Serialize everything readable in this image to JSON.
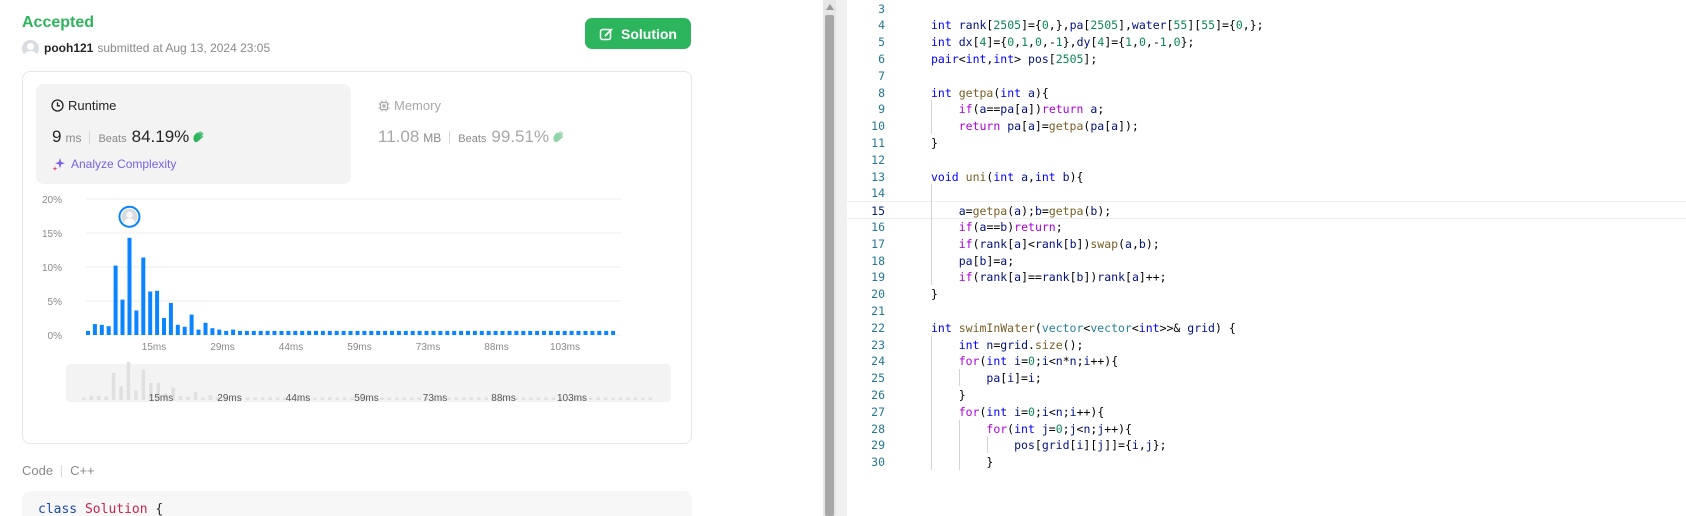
{
  "submission": {
    "status": "Accepted",
    "username": "pooh121",
    "submitted_text": "submitted at Aug 13, 2024 23:05",
    "solution_label": "Solution"
  },
  "runtime": {
    "title": "Runtime",
    "value": "9",
    "unit": "ms",
    "beats_label": "Beats",
    "beats_pct": "84.19%",
    "analyze_label": "Analyze Complexity"
  },
  "memory": {
    "title": "Memory",
    "value": "11.08",
    "unit": "MB",
    "beats_label": "Beats",
    "beats_pct": "99.51%"
  },
  "chart_data": {
    "type": "bar",
    "y_ticks": [
      "20%",
      "15%",
      "10%",
      "5%",
      "0%"
    ],
    "ylim": [
      0,
      20
    ],
    "x_tick_labels": [
      "15ms",
      "29ms",
      "44ms",
      "59ms",
      "73ms",
      "88ms",
      "103ms"
    ],
    "values": [
      0.6,
      1.6,
      1.5,
      1.3,
      10.2,
      5.2,
      14.3,
      3.6,
      11.4,
      6.4,
      6.5,
      2.5,
      4.7,
      1.5,
      1.2,
      3.0,
      0.8,
      1.8,
      1.0,
      0.8,
      0.6,
      0.8,
      0.6,
      0.6,
      0.6,
      0.6,
      0.6,
      0.6,
      0.6,
      0.6,
      0.6,
      0.6,
      0.6,
      0.6,
      0.6,
      0.6,
      0.6,
      0.6,
      0.6,
      0.6,
      0.6,
      0.6,
      0.6,
      0.6,
      0.6,
      0.6,
      0.6,
      0.6,
      0.6,
      0.6,
      0.6,
      0.6,
      0.6,
      0.6,
      0.6,
      0.6,
      0.6,
      0.6,
      0.6,
      0.6,
      0.6,
      0.6,
      0.6,
      0.6,
      0.6,
      0.6,
      0.6,
      0.6,
      0.6,
      0.6,
      0.6,
      0.6,
      0.6,
      0.6,
      0.6,
      0.6,
      0.6
    ],
    "highlight_index": 6,
    "bar_color": "#0a84ff",
    "overview_color": "#e0e0e0"
  },
  "code_section": {
    "label": "Code",
    "language": "C++",
    "preview_keyword": "class",
    "preview_name": "Solution",
    "preview_brace": "{"
  },
  "editor": {
    "active_line": "15",
    "lines": [
      {
        "n": "3",
        "code": ""
      },
      {
        "n": "4",
        "code": "int rank[2505]={0,},pa[2505],water[55][55]={0,};"
      },
      {
        "n": "5",
        "code": "int dx[4]={0,1,0,-1},dy[4]={1,0,-1,0};"
      },
      {
        "n": "6",
        "code": "pair<int,int> pos[2505];"
      },
      {
        "n": "7",
        "code": ""
      },
      {
        "n": "8",
        "code": "int getpa(int a){"
      },
      {
        "n": "9",
        "code": "    if(a==pa[a])return a;"
      },
      {
        "n": "10",
        "code": "    return pa[a]=getpa(pa[a]);"
      },
      {
        "n": "11",
        "code": "}"
      },
      {
        "n": "12",
        "code": ""
      },
      {
        "n": "13",
        "code": "void uni(int a,int b){"
      },
      {
        "n": "14",
        "code": ""
      },
      {
        "n": "15",
        "code": "    a=getpa(a);b=getpa(b);"
      },
      {
        "n": "16",
        "code": "    if(a==b)return;"
      },
      {
        "n": "17",
        "code": "    if(rank[a]<rank[b])swap(a,b);"
      },
      {
        "n": "18",
        "code": "    pa[b]=a;"
      },
      {
        "n": "19",
        "code": "    if(rank[a]==rank[b])rank[a]++;"
      },
      {
        "n": "20",
        "code": "}"
      },
      {
        "n": "21",
        "code": ""
      },
      {
        "n": "22",
        "code": "int swimInWater(vector<vector<int>>& grid) {"
      },
      {
        "n": "23",
        "code": "    int n=grid.size();"
      },
      {
        "n": "24",
        "code": "    for(int i=0;i<n*n;i++){"
      },
      {
        "n": "25",
        "code": "        pa[i]=i;"
      },
      {
        "n": "26",
        "code": "    }"
      },
      {
        "n": "27",
        "code": "    for(int i=0;i<n;i++){"
      },
      {
        "n": "28",
        "code": "        for(int j=0;j<n;j++){"
      },
      {
        "n": "29",
        "code": "            pos[grid[i][j]]={i,j};"
      },
      {
        "n": "30",
        "code": "        }"
      }
    ]
  }
}
